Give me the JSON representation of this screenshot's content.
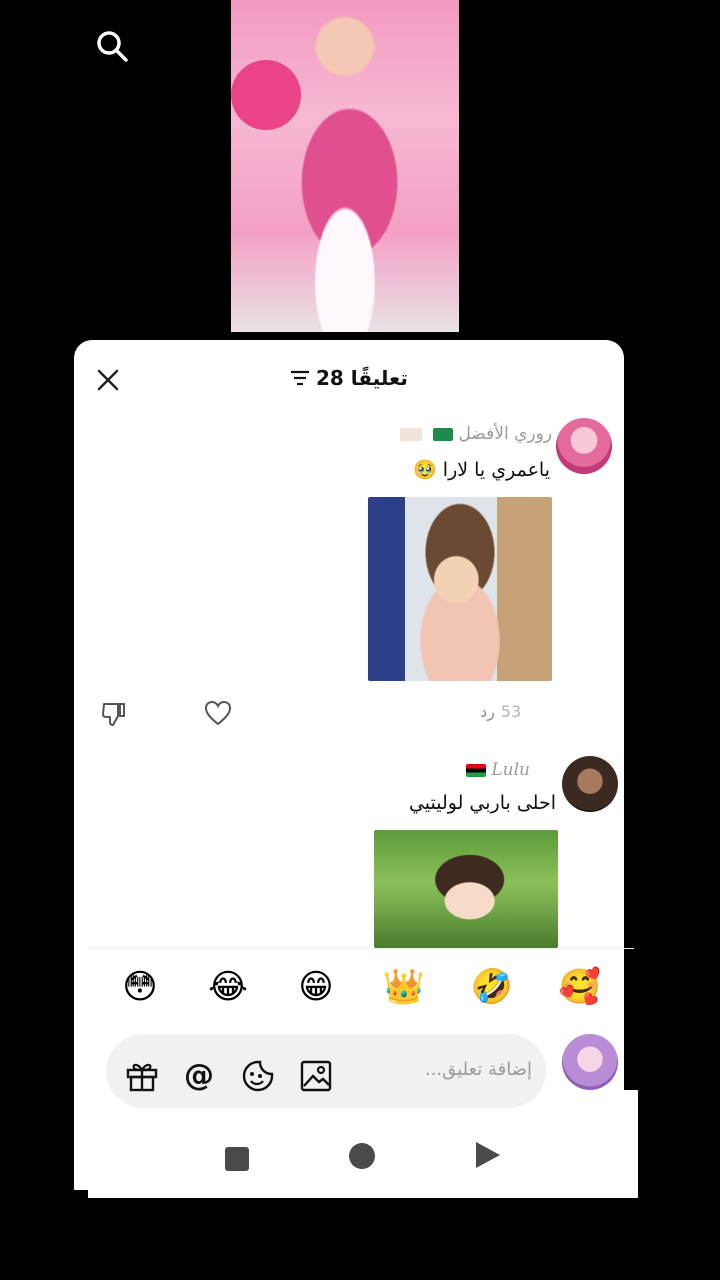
{
  "header": {
    "title": "28 تعليقًا"
  },
  "comments": [
    {
      "username": "روري الأفضل",
      "text": "ياعمري يا لارا 🥹",
      "likes": "53",
      "reply_label": "رد"
    },
    {
      "username": "Lulu",
      "text": "احلى باربي لوليتيي"
    }
  ],
  "emoji_bar": [
    "😳",
    "😂",
    "😁",
    "👑",
    "🤣",
    "🥰"
  ],
  "composer": {
    "placeholder": "إضافة تعليق..."
  },
  "colors": {
    "sheet_bg": "#ffffff",
    "page_bg": "#000000",
    "muted_text": "#9a9a9a"
  }
}
